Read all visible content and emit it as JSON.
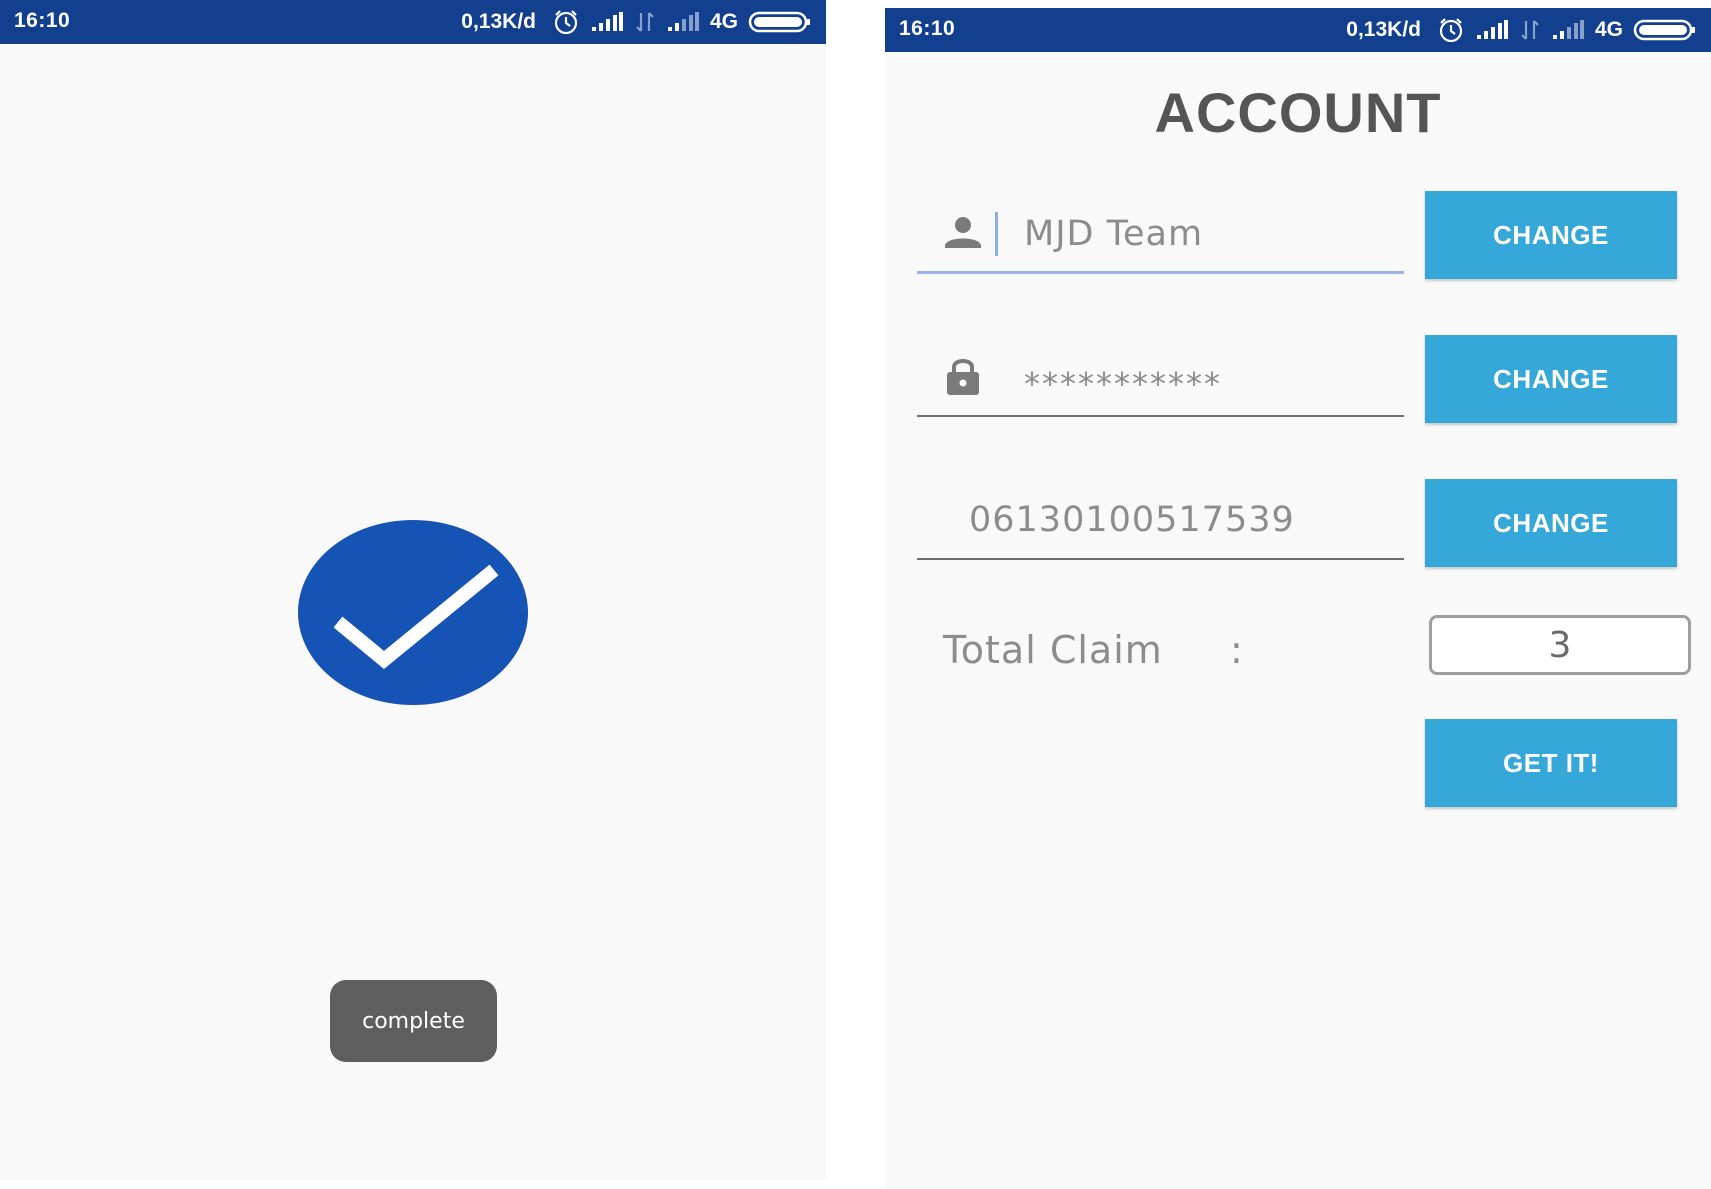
{
  "status_bar": {
    "time": "16:10",
    "network_speed": "0,13K/d",
    "network_type": "4G",
    "icons": [
      "alarm-icon",
      "signal-icon",
      "data-transfer-icon",
      "signal-weak-icon",
      "battery-icon"
    ]
  },
  "complete_screen": {
    "icon": "checkmark-circle-icon",
    "toast": "complete",
    "colors": {
      "circle": "#1553b4",
      "toast_bg": "#5e5e5e"
    }
  },
  "account_screen": {
    "title": "ACCOUNT",
    "fields": [
      {
        "icon": "person-icon",
        "value": "MJD Team",
        "focused": true
      },
      {
        "icon": "lock-icon",
        "value": "***********"
      },
      {
        "icon": "",
        "value": "06130100517539"
      }
    ],
    "change_label": "CHANGE",
    "total_claim_label": "Total Claim",
    "total_claim_separator": ":",
    "total_claim_value": "3",
    "get_it_label": "GET IT!",
    "colors": {
      "button": "#35a7d9",
      "status_bar": "#12408e",
      "title": "#555555"
    }
  }
}
